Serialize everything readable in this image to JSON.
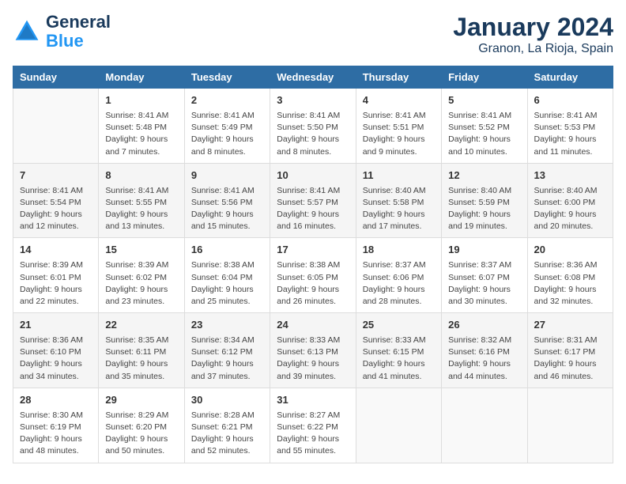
{
  "logo": {
    "line1": "General",
    "line2": "Blue"
  },
  "title": "January 2024",
  "subtitle": "Granon, La Rioja, Spain",
  "header": {
    "colors": {
      "blue": "#2e6da4"
    }
  },
  "days_of_week": [
    "Sunday",
    "Monday",
    "Tuesday",
    "Wednesday",
    "Thursday",
    "Friday",
    "Saturday"
  ],
  "weeks": [
    [
      {
        "day": "",
        "info": ""
      },
      {
        "day": "1",
        "info": "Sunrise: 8:41 AM\nSunset: 5:48 PM\nDaylight: 9 hours\nand 7 minutes."
      },
      {
        "day": "2",
        "info": "Sunrise: 8:41 AM\nSunset: 5:49 PM\nDaylight: 9 hours\nand 8 minutes."
      },
      {
        "day": "3",
        "info": "Sunrise: 8:41 AM\nSunset: 5:50 PM\nDaylight: 9 hours\nand 8 minutes."
      },
      {
        "day": "4",
        "info": "Sunrise: 8:41 AM\nSunset: 5:51 PM\nDaylight: 9 hours\nand 9 minutes."
      },
      {
        "day": "5",
        "info": "Sunrise: 8:41 AM\nSunset: 5:52 PM\nDaylight: 9 hours\nand 10 minutes."
      },
      {
        "day": "6",
        "info": "Sunrise: 8:41 AM\nSunset: 5:53 PM\nDaylight: 9 hours\nand 11 minutes."
      }
    ],
    [
      {
        "day": "7",
        "info": "Sunrise: 8:41 AM\nSunset: 5:54 PM\nDaylight: 9 hours\nand 12 minutes."
      },
      {
        "day": "8",
        "info": "Sunrise: 8:41 AM\nSunset: 5:55 PM\nDaylight: 9 hours\nand 13 minutes."
      },
      {
        "day": "9",
        "info": "Sunrise: 8:41 AM\nSunset: 5:56 PM\nDaylight: 9 hours\nand 15 minutes."
      },
      {
        "day": "10",
        "info": "Sunrise: 8:41 AM\nSunset: 5:57 PM\nDaylight: 9 hours\nand 16 minutes."
      },
      {
        "day": "11",
        "info": "Sunrise: 8:40 AM\nSunset: 5:58 PM\nDaylight: 9 hours\nand 17 minutes."
      },
      {
        "day": "12",
        "info": "Sunrise: 8:40 AM\nSunset: 5:59 PM\nDaylight: 9 hours\nand 19 minutes."
      },
      {
        "day": "13",
        "info": "Sunrise: 8:40 AM\nSunset: 6:00 PM\nDaylight: 9 hours\nand 20 minutes."
      }
    ],
    [
      {
        "day": "14",
        "info": "Sunrise: 8:39 AM\nSunset: 6:01 PM\nDaylight: 9 hours\nand 22 minutes."
      },
      {
        "day": "15",
        "info": "Sunrise: 8:39 AM\nSunset: 6:02 PM\nDaylight: 9 hours\nand 23 minutes."
      },
      {
        "day": "16",
        "info": "Sunrise: 8:38 AM\nSunset: 6:04 PM\nDaylight: 9 hours\nand 25 minutes."
      },
      {
        "day": "17",
        "info": "Sunrise: 8:38 AM\nSunset: 6:05 PM\nDaylight: 9 hours\nand 26 minutes."
      },
      {
        "day": "18",
        "info": "Sunrise: 8:37 AM\nSunset: 6:06 PM\nDaylight: 9 hours\nand 28 minutes."
      },
      {
        "day": "19",
        "info": "Sunrise: 8:37 AM\nSunset: 6:07 PM\nDaylight: 9 hours\nand 30 minutes."
      },
      {
        "day": "20",
        "info": "Sunrise: 8:36 AM\nSunset: 6:08 PM\nDaylight: 9 hours\nand 32 minutes."
      }
    ],
    [
      {
        "day": "21",
        "info": "Sunrise: 8:36 AM\nSunset: 6:10 PM\nDaylight: 9 hours\nand 34 minutes."
      },
      {
        "day": "22",
        "info": "Sunrise: 8:35 AM\nSunset: 6:11 PM\nDaylight: 9 hours\nand 35 minutes."
      },
      {
        "day": "23",
        "info": "Sunrise: 8:34 AM\nSunset: 6:12 PM\nDaylight: 9 hours\nand 37 minutes."
      },
      {
        "day": "24",
        "info": "Sunrise: 8:33 AM\nSunset: 6:13 PM\nDaylight: 9 hours\nand 39 minutes."
      },
      {
        "day": "25",
        "info": "Sunrise: 8:33 AM\nSunset: 6:15 PM\nDaylight: 9 hours\nand 41 minutes."
      },
      {
        "day": "26",
        "info": "Sunrise: 8:32 AM\nSunset: 6:16 PM\nDaylight: 9 hours\nand 44 minutes."
      },
      {
        "day": "27",
        "info": "Sunrise: 8:31 AM\nSunset: 6:17 PM\nDaylight: 9 hours\nand 46 minutes."
      }
    ],
    [
      {
        "day": "28",
        "info": "Sunrise: 8:30 AM\nSunset: 6:19 PM\nDaylight: 9 hours\nand 48 minutes."
      },
      {
        "day": "29",
        "info": "Sunrise: 8:29 AM\nSunset: 6:20 PM\nDaylight: 9 hours\nand 50 minutes."
      },
      {
        "day": "30",
        "info": "Sunrise: 8:28 AM\nSunset: 6:21 PM\nDaylight: 9 hours\nand 52 minutes."
      },
      {
        "day": "31",
        "info": "Sunrise: 8:27 AM\nSunset: 6:22 PM\nDaylight: 9 hours\nand 55 minutes."
      },
      {
        "day": "",
        "info": ""
      },
      {
        "day": "",
        "info": ""
      },
      {
        "day": "",
        "info": ""
      }
    ]
  ]
}
